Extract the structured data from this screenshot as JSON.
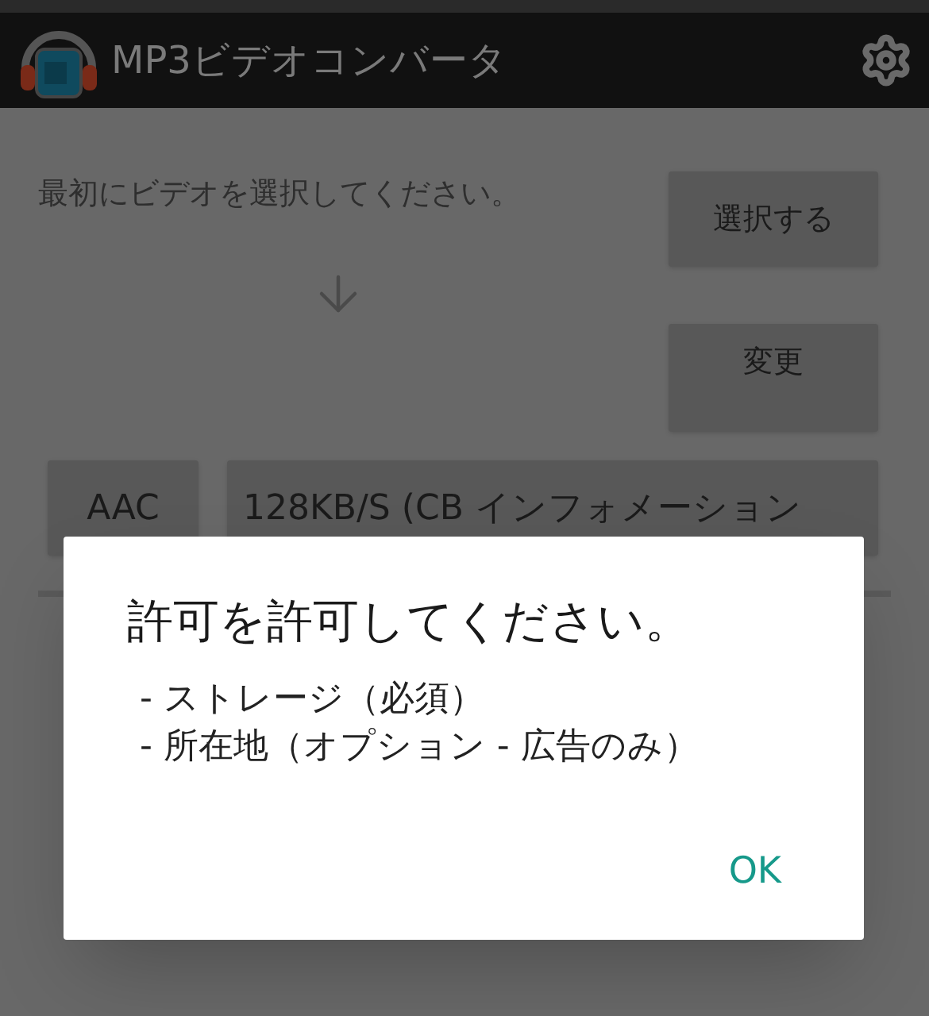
{
  "app_bar": {
    "title": "MP3ビデオコンバータ"
  },
  "main": {
    "instruction": "最初にビデオを選択してください。",
    "select_button": "選択する",
    "change_button": "変更",
    "format_button": "AAC",
    "bitrate_button": "128KB/S (CB インフォメーション"
  },
  "dialog": {
    "title": "許可を許可してください。",
    "lines": [
      "- ストレージ（必須）",
      "- 所在地（オプション - 広告のみ）"
    ],
    "ok_button": "OK"
  }
}
